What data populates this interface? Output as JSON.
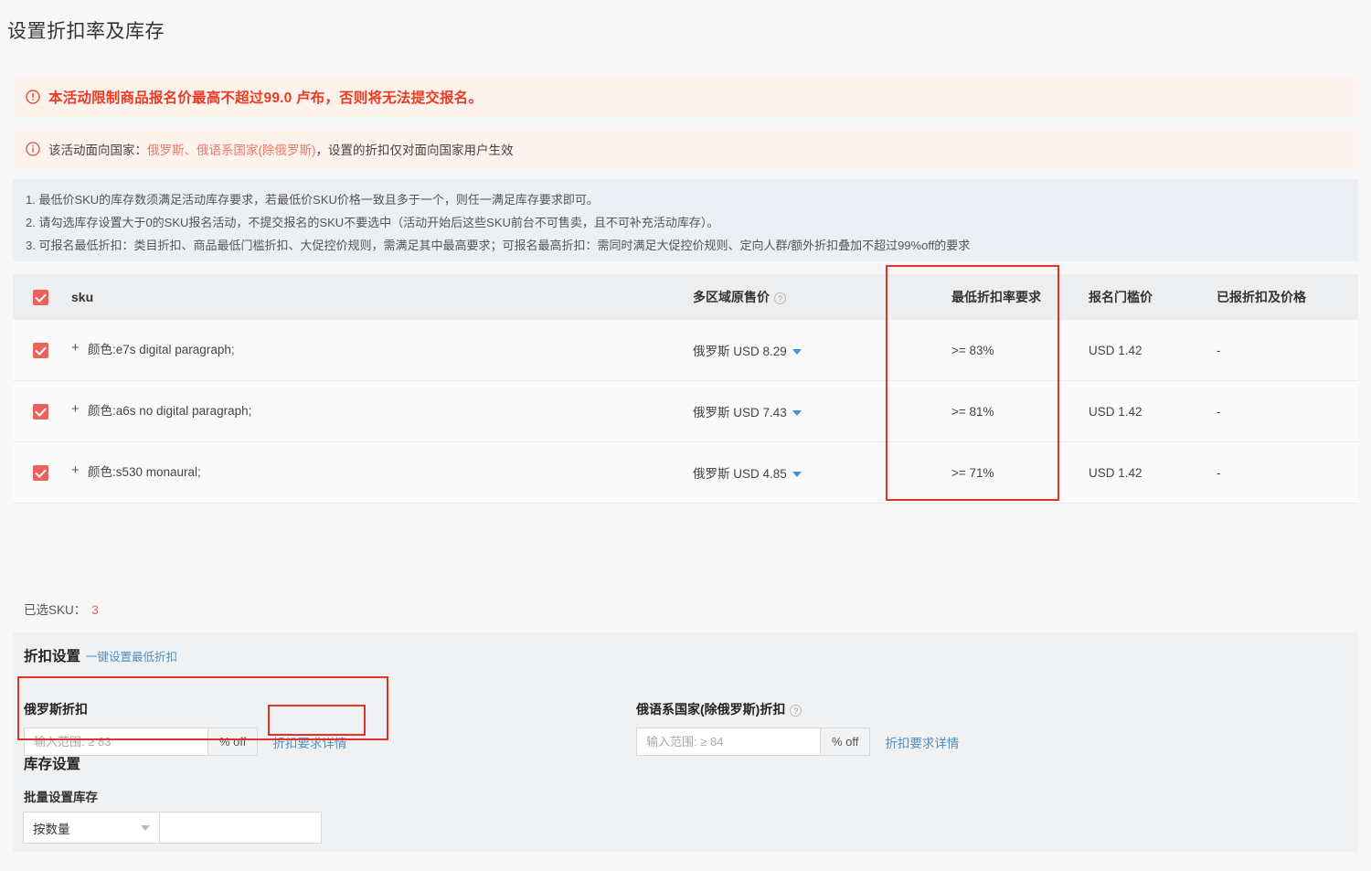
{
  "page": {
    "title": "设置折扣率及库存"
  },
  "banners": {
    "warning": {
      "icon": "exclamation-circle-icon",
      "text": "本活动限制商品报名价最高不超过99.0 卢布，否则将无法提交报名。"
    },
    "info": {
      "icon": "info-circle-icon",
      "prefix": "该活动面向国家：",
      "highlight": "俄罗斯、俄语系国家(除俄罗斯)",
      "suffix": "，设置的折扣仅对面向国家用户生效"
    }
  },
  "rules": [
    "1. 最低价SKU的库存数须满足活动库存要求，若最低价SKU价格一致且多于一个，则任一满足库存要求即可。",
    "2. 请勾选库存设置大于0的SKU报名活动，不提交报名的SKU不要选中（活动开始后这些SKU前台不可售卖，且不可补充活动库存）。",
    "3. 可报名最低折扣：类目折扣、商品最低门槛折扣、大促控价规则，需满足其中最高要求；可报名最高折扣：需同时满足大促控价规则、定向人群/额外折扣叠加不超过99%off的要求"
  ],
  "table": {
    "header": {
      "sku": "sku",
      "multi_region_price": "多区域原售价",
      "min_discount_required": "最低折扣率要求",
      "threshold_price": "报名门槛价",
      "applied_discount_price": "已报折扣及价格"
    },
    "header_checkbox_checked": true,
    "rows": [
      {
        "checked": true,
        "sku": "颜色:e7s digital paragraph;",
        "price_region": "俄罗斯",
        "price": "USD 8.29",
        "min_discount": ">= 83%",
        "threshold": "USD 1.42",
        "applied": "-"
      },
      {
        "checked": true,
        "sku": "颜色:a6s no digital paragraph;",
        "price_region": "俄罗斯",
        "price": "USD 7.43",
        "min_discount": ">= 81%",
        "threshold": "USD 1.42",
        "applied": "-"
      },
      {
        "checked": true,
        "sku": "颜色:s530 monaural;",
        "price_region": "俄罗斯",
        "price": "USD 4.85",
        "min_discount": ">= 71%",
        "threshold": "USD 1.42",
        "applied": "-"
      }
    ]
  },
  "selected": {
    "label": "已选SKU：",
    "count": "3"
  },
  "discount_settings": {
    "title": "折扣设置",
    "quick_link": "一键设置最低折扣",
    "russia": {
      "label": "俄罗斯折扣",
      "placeholder": "输入范围: ≥ 83",
      "value": "",
      "suffix": "% off",
      "detail_link": "折扣要求详情"
    },
    "russian_speaking": {
      "label": "俄语系国家(除俄罗斯)折扣",
      "help_icon": "question-circle-icon",
      "placeholder": "输入范围: ≥ 84",
      "value": "",
      "suffix": "% off",
      "detail_link": "折扣要求详情"
    }
  },
  "inventory_settings": {
    "title": "库存设置",
    "subtitle": "批量设置库存",
    "mode_selected": "按数量",
    "mode_options": [
      "按数量"
    ],
    "amount_value": "",
    "amount_placeholder": ""
  },
  "colors": {
    "accent_red": "#e8302a",
    "checkbox_red": "#e9625e",
    "link_blue": "#4a90c9",
    "warn_bg": "#fdf3ec",
    "rules_bg": "#eceff3",
    "panel_bg": "#f0f1f2"
  }
}
